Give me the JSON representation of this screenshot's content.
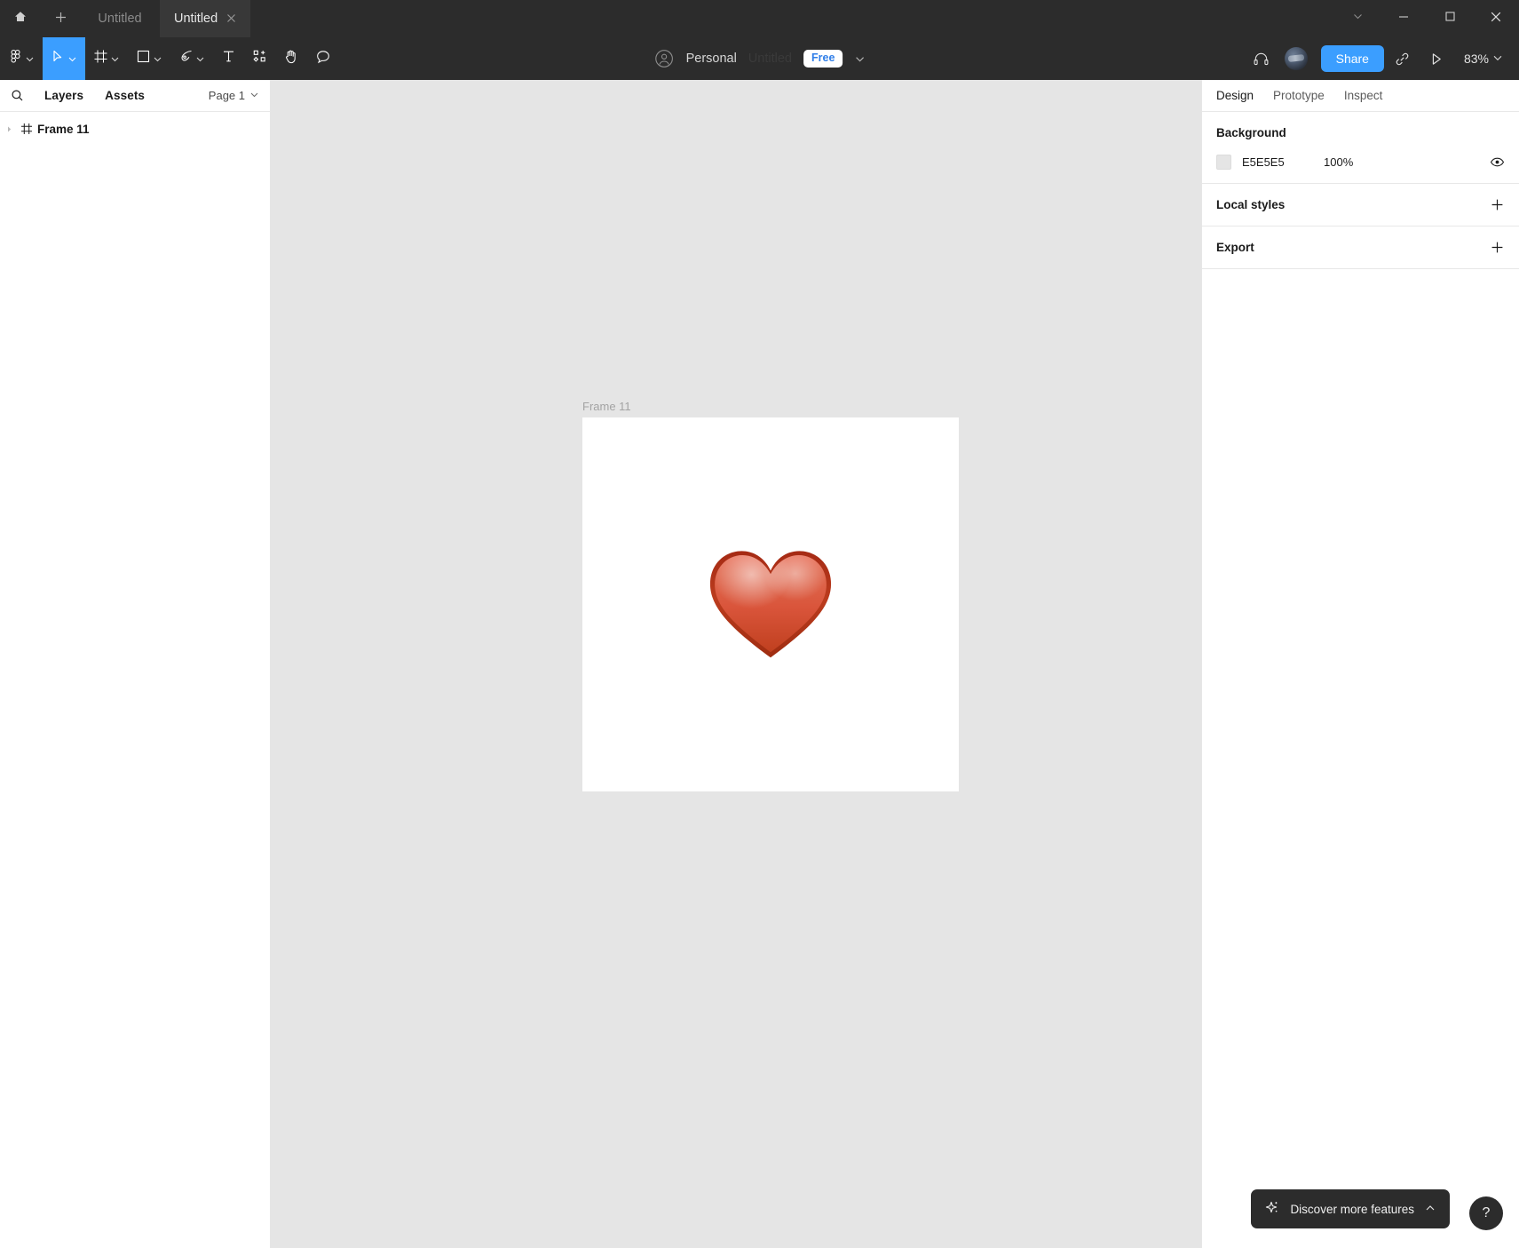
{
  "window": {
    "tabs": [
      {
        "label": "Untitled",
        "active": false
      },
      {
        "label": "Untitled",
        "active": true
      }
    ],
    "home_icon": "home-icon",
    "new_tab_icon": "plus-icon",
    "close_tab_icon": "close-icon",
    "controls": {
      "chevron": "chevron-down-icon",
      "minimize": "minimize-icon",
      "maximize": "maximize-icon",
      "close": "close-icon"
    }
  },
  "toolbar": {
    "tools": [
      {
        "name": "figma-menu",
        "icon": "figma-logo-icon",
        "caret": true,
        "selected": false
      },
      {
        "name": "move-tool",
        "icon": "cursor-arrow-icon",
        "caret": true,
        "selected": true
      },
      {
        "name": "frame-tool",
        "icon": "frame-icon",
        "caret": true,
        "selected": false
      },
      {
        "name": "shape-tool",
        "icon": "square-icon",
        "caret": true,
        "selected": false
      },
      {
        "name": "pen-tool",
        "icon": "pen-icon",
        "caret": true,
        "selected": false
      },
      {
        "name": "text-tool",
        "icon": "text-icon",
        "caret": false,
        "selected": false
      },
      {
        "name": "resources-tool",
        "icon": "components-icon",
        "caret": false,
        "selected": false
      },
      {
        "name": "hand-tool",
        "icon": "hand-icon",
        "caret": false,
        "selected": false
      },
      {
        "name": "comment-tool",
        "icon": "comment-icon",
        "caret": false,
        "selected": false
      }
    ],
    "account_label": "Personal",
    "file_name": "Untitled",
    "plan_badge": "Free",
    "plan_caret": "chevron-down-icon",
    "headphones_icon": "headphones-icon",
    "avatar": "user-avatar",
    "share_label": "Share",
    "link_icon": "link-icon",
    "present_icon": "play-icon",
    "zoom_level": "83%",
    "zoom_caret": "chevron-down-icon"
  },
  "left_panel": {
    "search_icon": "search-icon",
    "tabs": [
      {
        "label": "Layers",
        "active": true
      },
      {
        "label": "Assets",
        "active": false
      }
    ],
    "page_selector": "Page 1",
    "page_caret": "chevron-down-icon",
    "layers": [
      {
        "name": "Frame 11",
        "icon": "frame-icon",
        "expand_icon": "chevron-right-icon"
      }
    ]
  },
  "canvas": {
    "background_color": "#E5E5E5",
    "frame_label": "Frame 11",
    "frame_fill": "#FFFFFF",
    "content_icon": "red-heart-emoji"
  },
  "right_panel": {
    "tabs": [
      {
        "label": "Design",
        "active": true
      },
      {
        "label": "Prototype",
        "active": false
      },
      {
        "label": "Inspect",
        "active": false
      }
    ],
    "background": {
      "title": "Background",
      "color_hex": "E5E5E5",
      "opacity": "100%",
      "visibility_icon": "eye-icon"
    },
    "local_styles": {
      "title": "Local styles",
      "add_icon": "plus-icon"
    },
    "export": {
      "title": "Export",
      "add_icon": "plus-icon"
    }
  },
  "overlays": {
    "discover_label": "Discover more features",
    "discover_icon": "sparkle-icon",
    "discover_caret": "chevron-up-icon",
    "help_label": "?"
  }
}
